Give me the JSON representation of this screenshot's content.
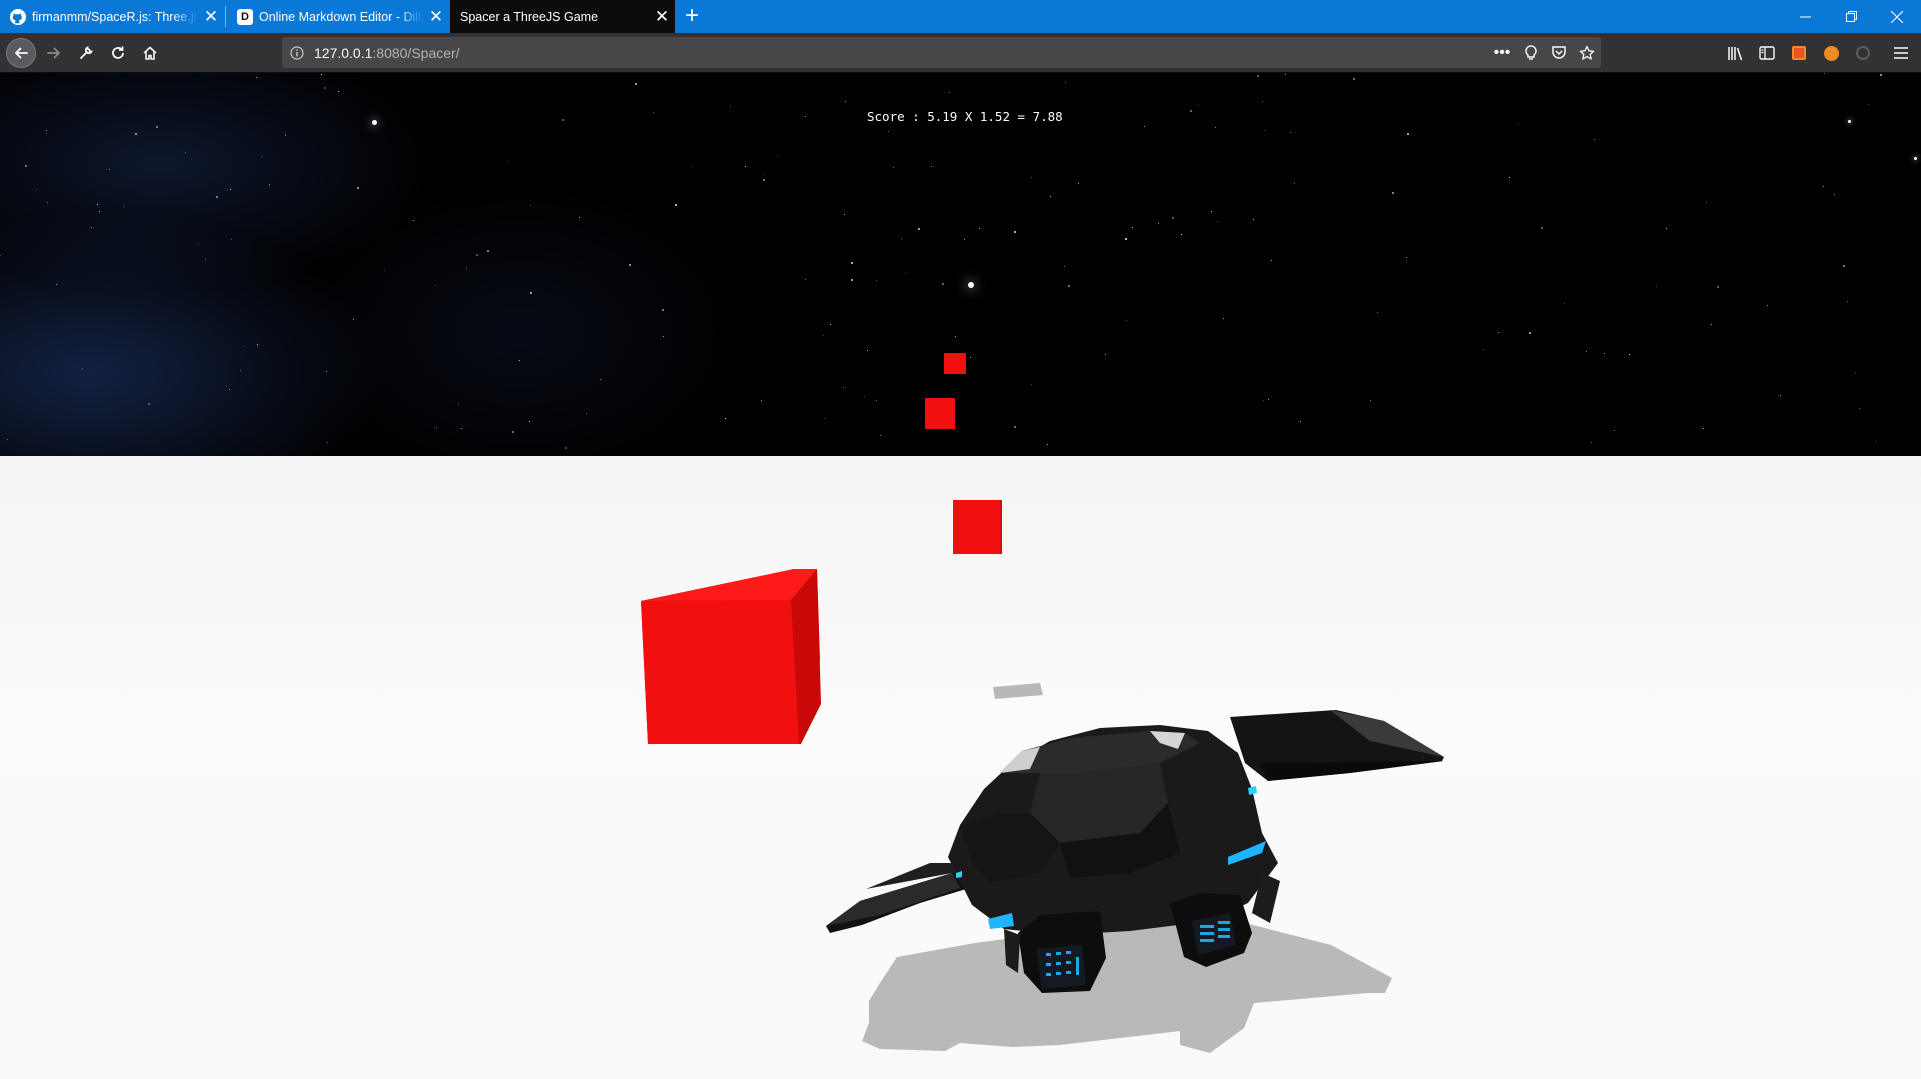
{
  "browser": {
    "tabs": [
      {
        "label": "firmanmm/SpaceR.js: Three.js Game",
        "icon": "github-icon",
        "active": false
      },
      {
        "label": "Online Markdown Editor - Dillinger",
        "icon": "dillinger-icon",
        "favicon_text": "D",
        "active": false
      },
      {
        "label": "Spacer a ThreeJS Game",
        "icon": null,
        "active": true
      }
    ],
    "url": {
      "host": "127.0.0.1",
      "rest": ":8080/Spacer/"
    }
  },
  "game": {
    "score_text": "Score : 5.19 X 1.52 = 7.88"
  },
  "colors": {
    "titlebar": "#0a78d7",
    "toolbar": "#323234",
    "cube": "#f01010",
    "space": "#000000",
    "ground": "#f7f7f7"
  }
}
